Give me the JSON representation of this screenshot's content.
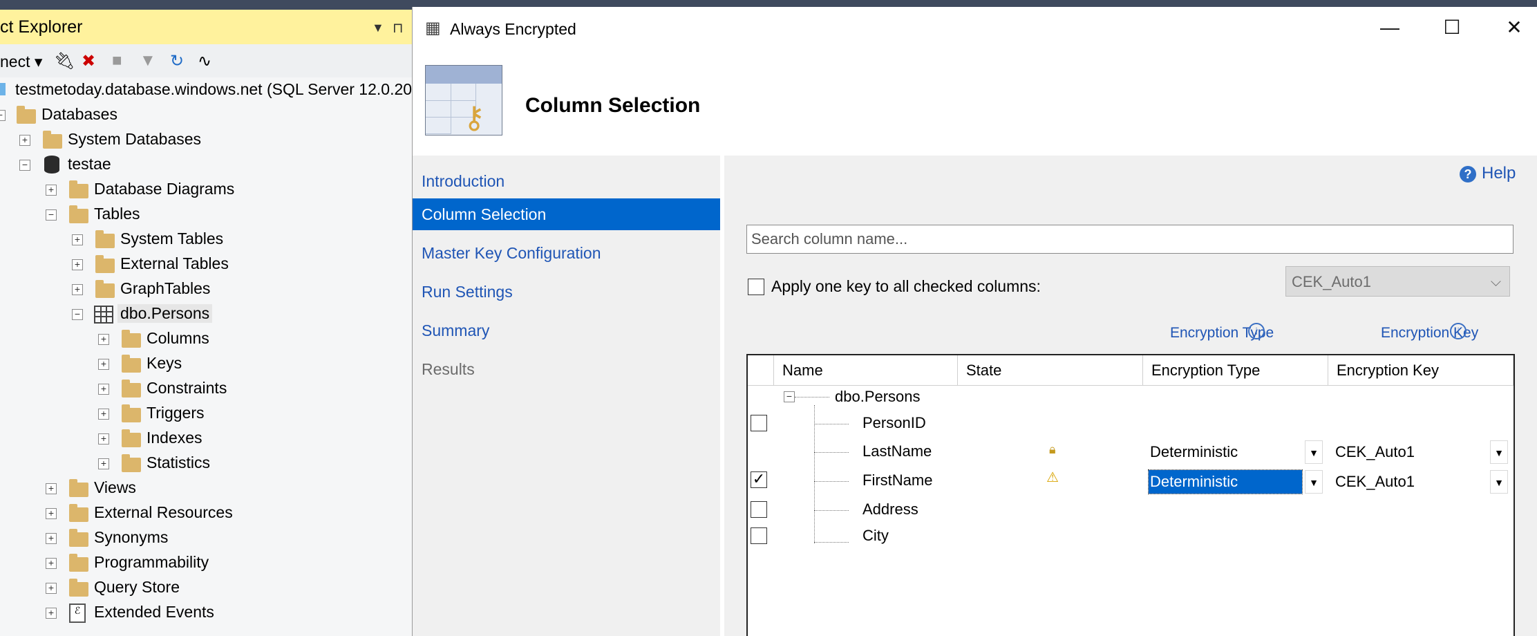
{
  "object_explorer": {
    "title": "ct Explorer",
    "connect_label": "nect",
    "server": "testmetoday.database.windows.net (SQL Server 12.0.20",
    "nodes": [
      "Databases",
      "System Databases",
      "testae",
      "Database Diagrams",
      "Tables",
      "System Tables",
      "External Tables",
      "GraphTables",
      "dbo.Persons",
      "Columns",
      "Keys",
      "Constraints",
      "Triggers",
      "Indexes",
      "Statistics",
      "Views",
      "External Resources",
      "Synonyms",
      "Programmability",
      "Query Store",
      "Extended Events"
    ]
  },
  "dialog": {
    "title": "Always Encrypted",
    "header_title": "Column Selection",
    "nav": [
      "Introduction",
      "Column Selection",
      "Master Key Configuration",
      "Run Settings",
      "Summary",
      "Results"
    ],
    "help_label": "Help",
    "search_placeholder": "Search column name...",
    "apply_label": "Apply one key to all checked columns:",
    "apply_key_value": "CEK_Auto1",
    "encryption_type_link": "Encryption Type",
    "encryption_key_link": "Encryption Key",
    "grid": {
      "headers": [
        "Name",
        "State",
        "Encryption Type",
        "Encryption Key"
      ],
      "table_name": "dbo.Persons",
      "rows": [
        {
          "name": "PersonID",
          "checked": false,
          "state": "",
          "type": "",
          "key": ""
        },
        {
          "name": "LastName",
          "checked": false,
          "state": "lock",
          "type": "Deterministic",
          "key": "CEK_Auto1"
        },
        {
          "name": "FirstName",
          "checked": true,
          "state": "warning",
          "type": "Deterministic",
          "key": "CEK_Auto1"
        },
        {
          "name": "Address",
          "checked": false,
          "state": "",
          "type": "",
          "key": ""
        },
        {
          "name": "City",
          "checked": false,
          "state": "",
          "type": "",
          "key": ""
        }
      ]
    }
  }
}
